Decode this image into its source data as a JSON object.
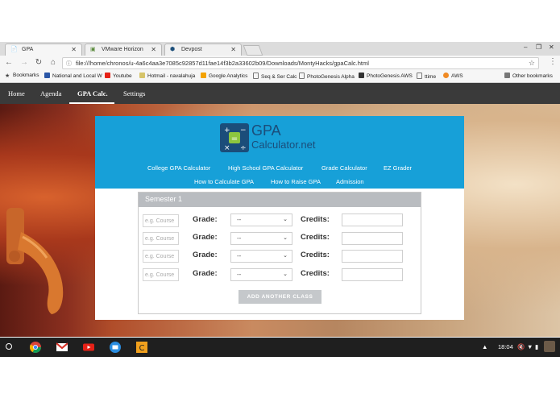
{
  "browser": {
    "tabs": [
      {
        "title": "GPA",
        "icon": "page-icon"
      },
      {
        "title": "VMware Horizon",
        "icon": "vmware-icon"
      },
      {
        "title": "Devpost",
        "icon": "devpost-icon"
      }
    ],
    "url": "file:///home/chronos/u-4a6c4aa3e7085c92857d11fae14f3b2a33602b09/Downloads/MontyHacks/gpaCalc.html",
    "bookmarks": [
      "Bookmarks",
      "National and Local W",
      "Youtube",
      "Hotmail - navalahuja",
      "Google Analytics",
      "Seq & Ser Calc",
      "PhotoGenesis Alpha",
      "PhotoGenesis AWS",
      "ttime",
      "AWS"
    ],
    "other_bookmarks": "Other bookmarks"
  },
  "site_nav": {
    "items": [
      "Home",
      "Agenda",
      "GPA Calc.",
      "Settings"
    ],
    "active": "GPA Calc."
  },
  "gpa_site": {
    "logo_line1": "GPA",
    "logo_line2": "Calculator.net",
    "links_row1": [
      "College GPA Calculator",
      "High School GPA Calculator",
      "Grade Calculator",
      "EZ Grader"
    ],
    "links_row2": [
      "How to Calculate GPA",
      "How to Raise GPA",
      "Admission"
    ],
    "semester_title": "Semester 1",
    "course_placeholder": "e.g. Course",
    "grade_label": "Grade:",
    "grade_default": "--",
    "credits_label": "Credits:",
    "add_button": "ADD ANOTHER CLASS"
  },
  "taskbar": {
    "time": "18:04"
  },
  "colors": {
    "header_blue": "#17a0d8",
    "logo_navy": "#1b4d7a",
    "site_nav_bg": "#3a3a3a"
  }
}
